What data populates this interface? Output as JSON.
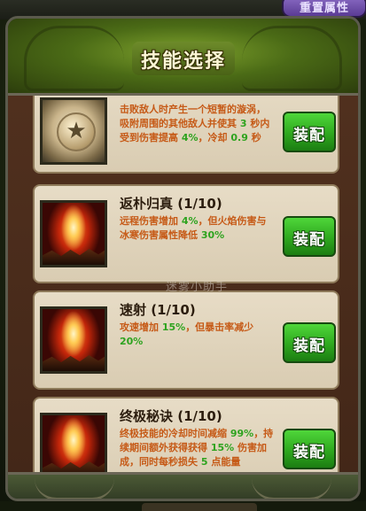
{
  "top": {
    "reset_button": "重置属性"
  },
  "header": {
    "title": "技能选择"
  },
  "watermark": "迷雾小助手",
  "skills": [
    {
      "name": "",
      "icon": "coin-star-icon",
      "desc_parts": [
        "击败敌人时产生一个短暂的漩涡，吸附周围的其他敌人并使其 ",
        "3",
        " 秒内受到伤害提高 ",
        "4%",
        "，冷却 ",
        "0.9",
        " 秒"
      ],
      "button": "装配"
    },
    {
      "name": "返朴归真 (1/10)",
      "icon": "flame-burst-icon",
      "desc_parts": [
        "远程伤害增加 ",
        "4%",
        "，但火焰伤害与冰寒伤害属性降低 ",
        "30%"
      ],
      "button": "装配"
    },
    {
      "name": "速射 (1/10)",
      "icon": "flame-burst-icon",
      "desc_parts": [
        "攻速增加 ",
        "15%",
        "，但暴击率减少 ",
        "20%"
      ],
      "button": "装配"
    },
    {
      "name": "终极秘诀 (1/10)",
      "icon": "flame-burst-icon",
      "desc_parts": [
        "终极技能的冷却时间减缩 ",
        "99%",
        "，持续期间额外获得获得 ",
        "15%",
        " 伤害加成，同时每秒损失 ",
        "5",
        " 点能量"
      ],
      "button": "装配"
    }
  ]
}
